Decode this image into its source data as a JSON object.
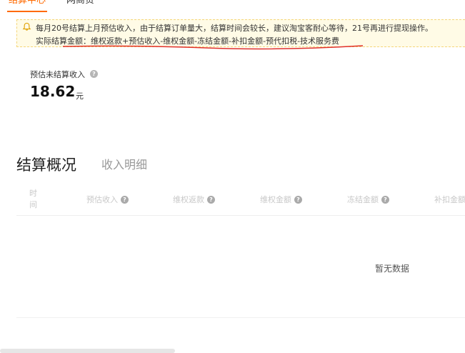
{
  "top_tabs": [
    {
      "label": "结算中心",
      "active": true
    },
    {
      "label": "网商贷",
      "active": false
    }
  ],
  "notice": {
    "line1": "每月20号结算上月预估收入，由于结算订单量大，结算时间会较长，建议淘宝客耐心等待，21号再进行提现操作。",
    "line2": "实际结算金额：维权返款+预估收入-维权金额-冻结金额-补扣金额-预代扣税-技术服务费",
    "bg_color": "#fffbe6",
    "icon": "bell-icon"
  },
  "estimate": {
    "label": "预估未结算收入",
    "amount": "18.62",
    "unit": "元"
  },
  "section": {
    "title": "结算概况",
    "tab": "收入明细"
  },
  "table": {
    "headers": [
      "时间",
      "预估收入",
      "维权返款",
      "维权金额",
      "冻结金额",
      "补扣金额"
    ],
    "empty_text": "暂无数据"
  },
  "colors": {
    "accent": "#ff6a00",
    "annotation": "#e0302a"
  }
}
